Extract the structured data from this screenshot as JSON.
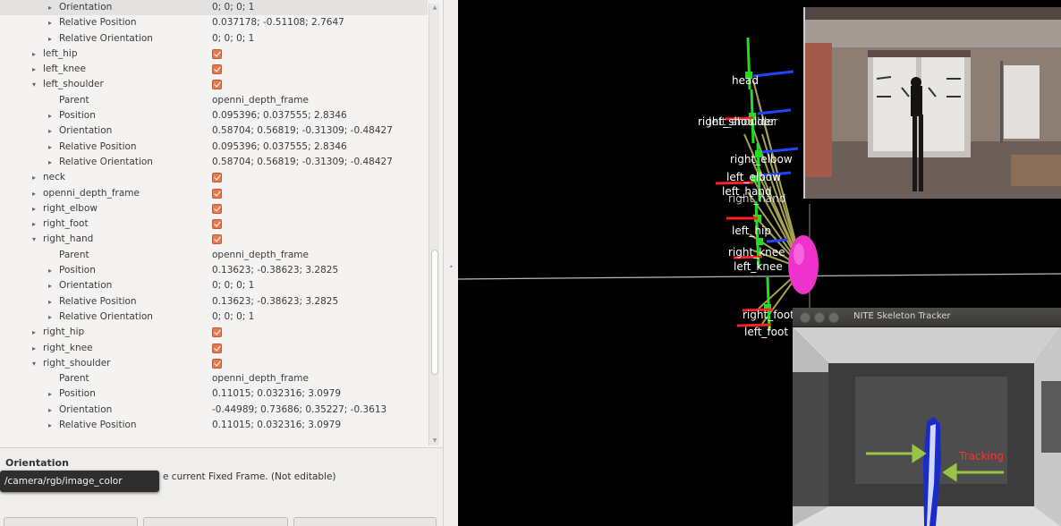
{
  "tree": {
    "rows": [
      {
        "indent": 2,
        "arrow": "▸",
        "label": "Orientation",
        "value": "0; 0; 0; 1",
        "selected": true
      },
      {
        "indent": 2,
        "arrow": "▸",
        "label": "Relative Position",
        "value": "0.037178; -0.51108; 2.7647"
      },
      {
        "indent": 2,
        "arrow": "▸",
        "label": "Relative Orientation",
        "value": "0; 0; 0; 1"
      },
      {
        "indent": 1,
        "arrow": "▸",
        "label": "left_hip",
        "check": true
      },
      {
        "indent": 1,
        "arrow": "▸",
        "label": "left_knee",
        "check": true
      },
      {
        "indent": 1,
        "arrow": "▾",
        "label": "left_shoulder",
        "check": true
      },
      {
        "indent": 2,
        "arrow": "",
        "label": "Parent",
        "value": "openni_depth_frame"
      },
      {
        "indent": 2,
        "arrow": "▸",
        "label": "Position",
        "value": "0.095396; 0.037555; 2.8346"
      },
      {
        "indent": 2,
        "arrow": "▸",
        "label": "Orientation",
        "value": "0.58704; 0.56819; -0.31309; -0.48427"
      },
      {
        "indent": 2,
        "arrow": "▸",
        "label": "Relative Position",
        "value": "0.095396; 0.037555; 2.8346"
      },
      {
        "indent": 2,
        "arrow": "▸",
        "label": "Relative Orientation",
        "value": "0.58704; 0.56819; -0.31309; -0.48427"
      },
      {
        "indent": 1,
        "arrow": "▸",
        "label": "neck",
        "check": true
      },
      {
        "indent": 1,
        "arrow": "▸",
        "label": "openni_depth_frame",
        "check": true
      },
      {
        "indent": 1,
        "arrow": "▸",
        "label": "right_elbow",
        "check": true
      },
      {
        "indent": 1,
        "arrow": "▸",
        "label": "right_foot",
        "check": true
      },
      {
        "indent": 1,
        "arrow": "▾",
        "label": "right_hand",
        "check": true
      },
      {
        "indent": 2,
        "arrow": "",
        "label": "Parent",
        "value": "openni_depth_frame"
      },
      {
        "indent": 2,
        "arrow": "▸",
        "label": "Position",
        "value": "0.13623; -0.38623; 3.2825"
      },
      {
        "indent": 2,
        "arrow": "▸",
        "label": "Orientation",
        "value": "0; 0; 0; 1"
      },
      {
        "indent": 2,
        "arrow": "▸",
        "label": "Relative Position",
        "value": "0.13623; -0.38623; 3.2825"
      },
      {
        "indent": 2,
        "arrow": "▸",
        "label": "Relative Orientation",
        "value": "0; 0; 0; 1"
      },
      {
        "indent": 1,
        "arrow": "▸",
        "label": "right_hip",
        "check": true
      },
      {
        "indent": 1,
        "arrow": "▸",
        "label": "right_knee",
        "check": true
      },
      {
        "indent": 1,
        "arrow": "▾",
        "label": "right_shoulder",
        "check": true
      },
      {
        "indent": 2,
        "arrow": "",
        "label": "Parent",
        "value": "openni_depth_frame"
      },
      {
        "indent": 2,
        "arrow": "▸",
        "label": "Position",
        "value": "0.11015; 0.032316; 3.0979"
      },
      {
        "indent": 2,
        "arrow": "▸",
        "label": "Orientation",
        "value": "-0.44989; 0.73686; 0.35227; -0.3613"
      },
      {
        "indent": 2,
        "arrow": "▸",
        "label": "Relative Position",
        "value": "0.11015; 0.032316; 3.0979"
      }
    ]
  },
  "description": {
    "title": "Orientation",
    "text": "e current Fixed Frame. (Not editable)"
  },
  "tooltip": {
    "text": "/camera/rgb/image_color"
  },
  "scene": {
    "labels": [
      "head",
      "right_shoulder",
      "left_shoulder",
      "right_elbow",
      "left_elbow",
      "left_hand",
      "right_hand",
      "left_hip",
      "right_knee",
      "left_knee",
      "right_foot",
      "left_foot"
    ]
  },
  "nite": {
    "window_title": "NITE Skeleton Tracker",
    "status": "Tracking"
  },
  "colors": {
    "checkbox": "#e87a4d",
    "skeleton_green": "#22dd22",
    "axis_red": "#ff2222",
    "axis_blue": "#2244ff",
    "link_yellow": "#b9b35a",
    "marker_magenta": "#ee33cc",
    "tracking_red": "#ff3030",
    "arrow_green": "#9ac542"
  }
}
